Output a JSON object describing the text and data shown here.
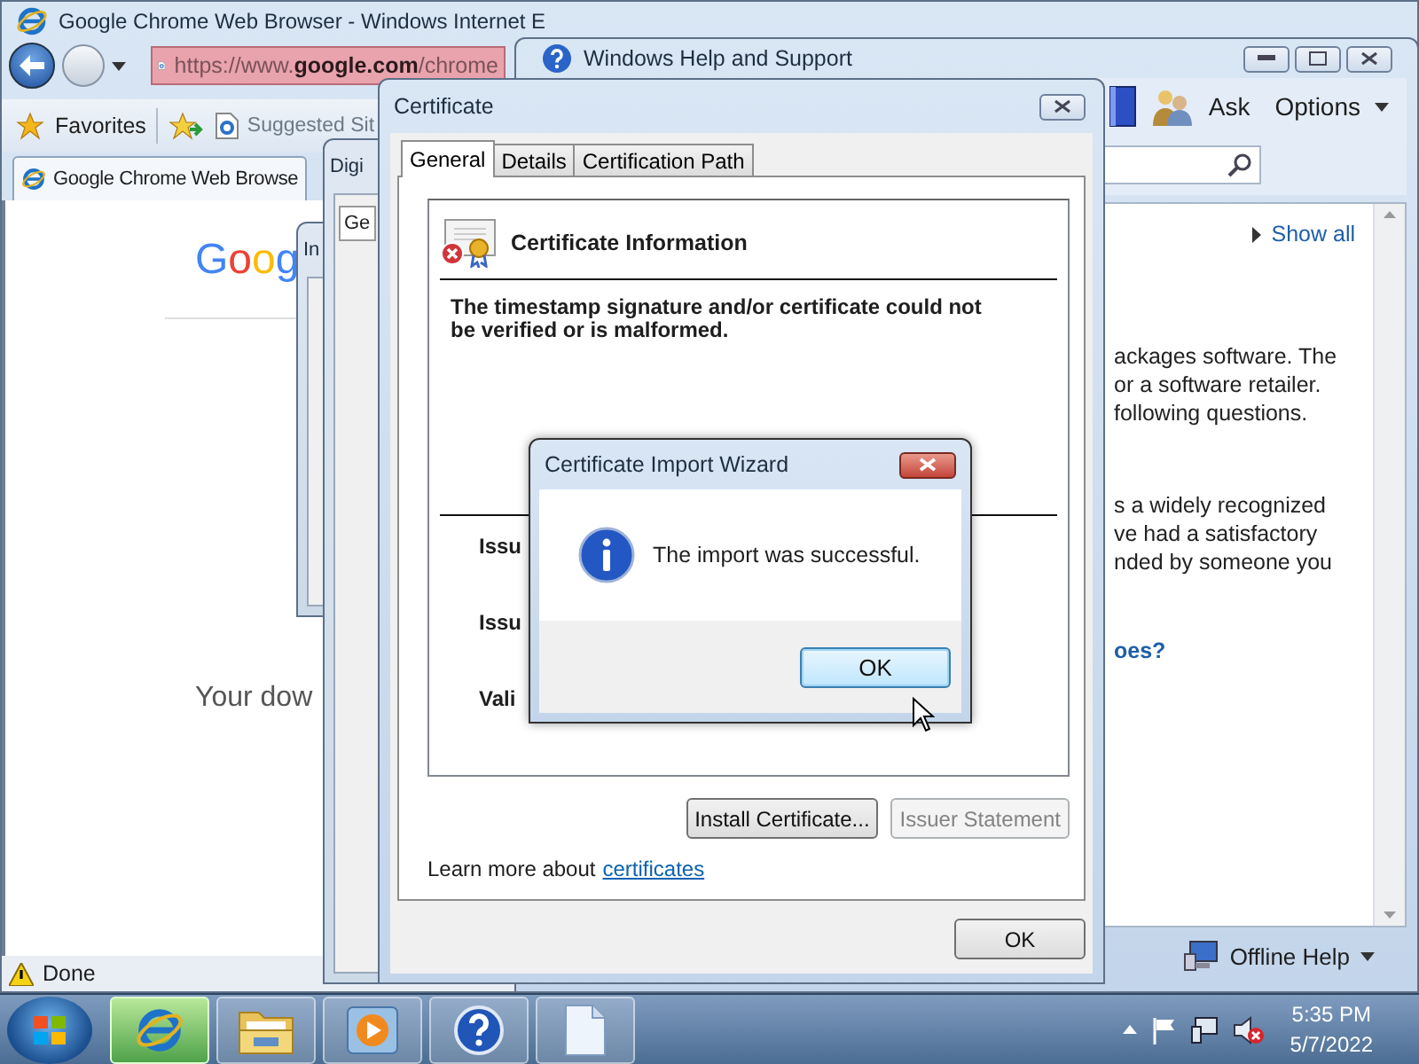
{
  "ie_window": {
    "title": "Google Chrome Web Browser - Windows Internet E",
    "address": "https://www.**google.com**/chrome",
    "favorites": "Favorites",
    "suggested_sites": "Suggested Sit",
    "tab": "Google Chrome Web Browse",
    "logo": "Goog",
    "page_text": "Your dow",
    "status": "Done"
  },
  "help_window": {
    "title": "Windows Help and Support",
    "ask": "Ask",
    "options": "Options",
    "show_all": "Show all",
    "paragraphs": [
      {
        "lines": [
          "ackages software. The",
          "or a software retailer.",
          "following questions."
        ]
      },
      {
        "lines": [
          "s a widely recognized",
          "ve had a satisfactory",
          "nded by someone you"
        ]
      }
    ],
    "link": "oes?",
    "offline_help": "Offline Help"
  },
  "back_dialogs": [
    {
      "title": "In"
    },
    {
      "title": "Digi",
      "tab": "Ge"
    }
  ],
  "certificate_window": {
    "title": "Certificate",
    "tabs": [
      {
        "label": "General",
        "selected": true
      },
      {
        "label": "Details",
        "selected": false
      },
      {
        "label": "Certification Path",
        "selected": false
      }
    ],
    "heading": "Certificate Information",
    "message": "The timestamp signature and/or certificate could not be verified or is malformed.",
    "field_labels": [
      "Issu",
      "Issu",
      "Vali"
    ],
    "buttons": [
      {
        "label": "Install Certificate...",
        "disabled": false
      },
      {
        "label": "Issuer Statement",
        "disabled": true
      }
    ],
    "learn_more": "Learn more about",
    "learn_link": "certificates",
    "ok": "OK"
  },
  "wizard": {
    "title": "Certificate Import Wizard",
    "message": "The import was successful.",
    "ok": "OK"
  },
  "taskbar": {
    "items": [
      {
        "kind": "browser",
        "selected": true
      },
      {
        "kind": "folder",
        "selected": false
      },
      {
        "kind": "media",
        "selected": false
      },
      {
        "kind": "help",
        "selected": false
      },
      {
        "kind": "document",
        "selected": false
      }
    ],
    "time": "5:35 PM",
    "date": "5/7/2022"
  }
}
